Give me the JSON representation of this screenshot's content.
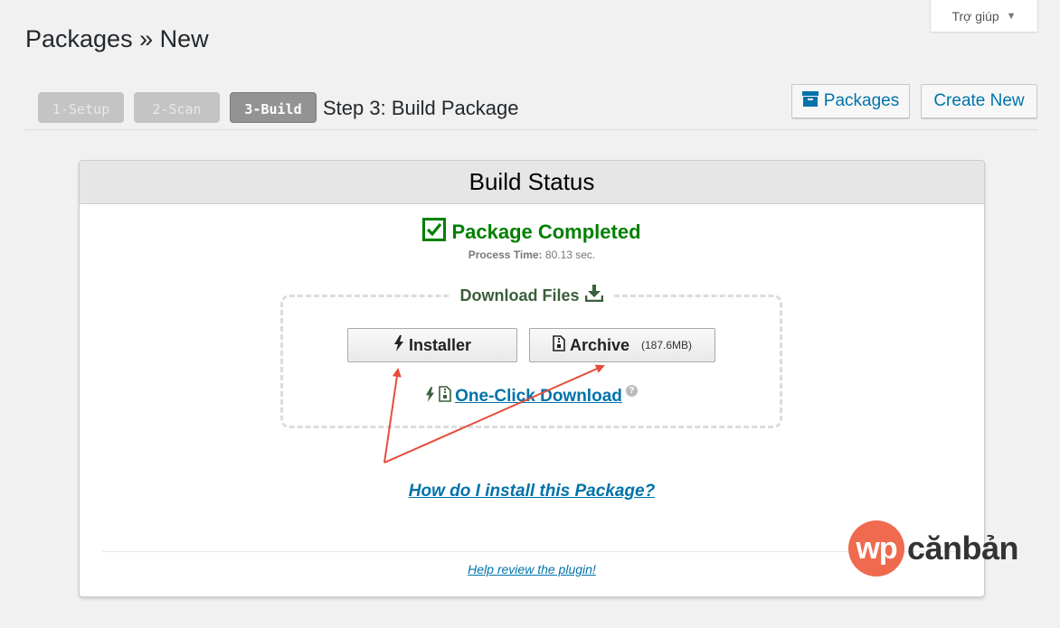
{
  "help_tab": {
    "label": "Trợ giúp"
  },
  "page_title": "Packages » New",
  "steps": [
    {
      "label": "1-Setup",
      "state": "inactive"
    },
    {
      "label": "2-Scan",
      "state": "inactive"
    },
    {
      "label": "3-Build",
      "state": "active"
    }
  ],
  "step_title": "Step 3: Build Package",
  "top_actions": {
    "packages_label": "Packages",
    "create_new_label": "Create New"
  },
  "panel": {
    "title": "Build Status",
    "status": "Package Completed",
    "process_time_label": "Process Time:",
    "process_time_value": "80.13 sec.",
    "download_title": "Download Files",
    "installer_label": "Installer",
    "archive_label": "Archive",
    "archive_size": "(187.6MB)",
    "one_click_label": "One-Click Download",
    "howto_label": "How do I install this Package?",
    "review_label": "Help review the plugin!"
  },
  "watermark": {
    "badge": "wp",
    "text": "cănbản"
  },
  "colors": {
    "accent": "#0073aa",
    "success": "#008000",
    "annotation": "#e74c3c",
    "logo": "#ef6a4e"
  }
}
